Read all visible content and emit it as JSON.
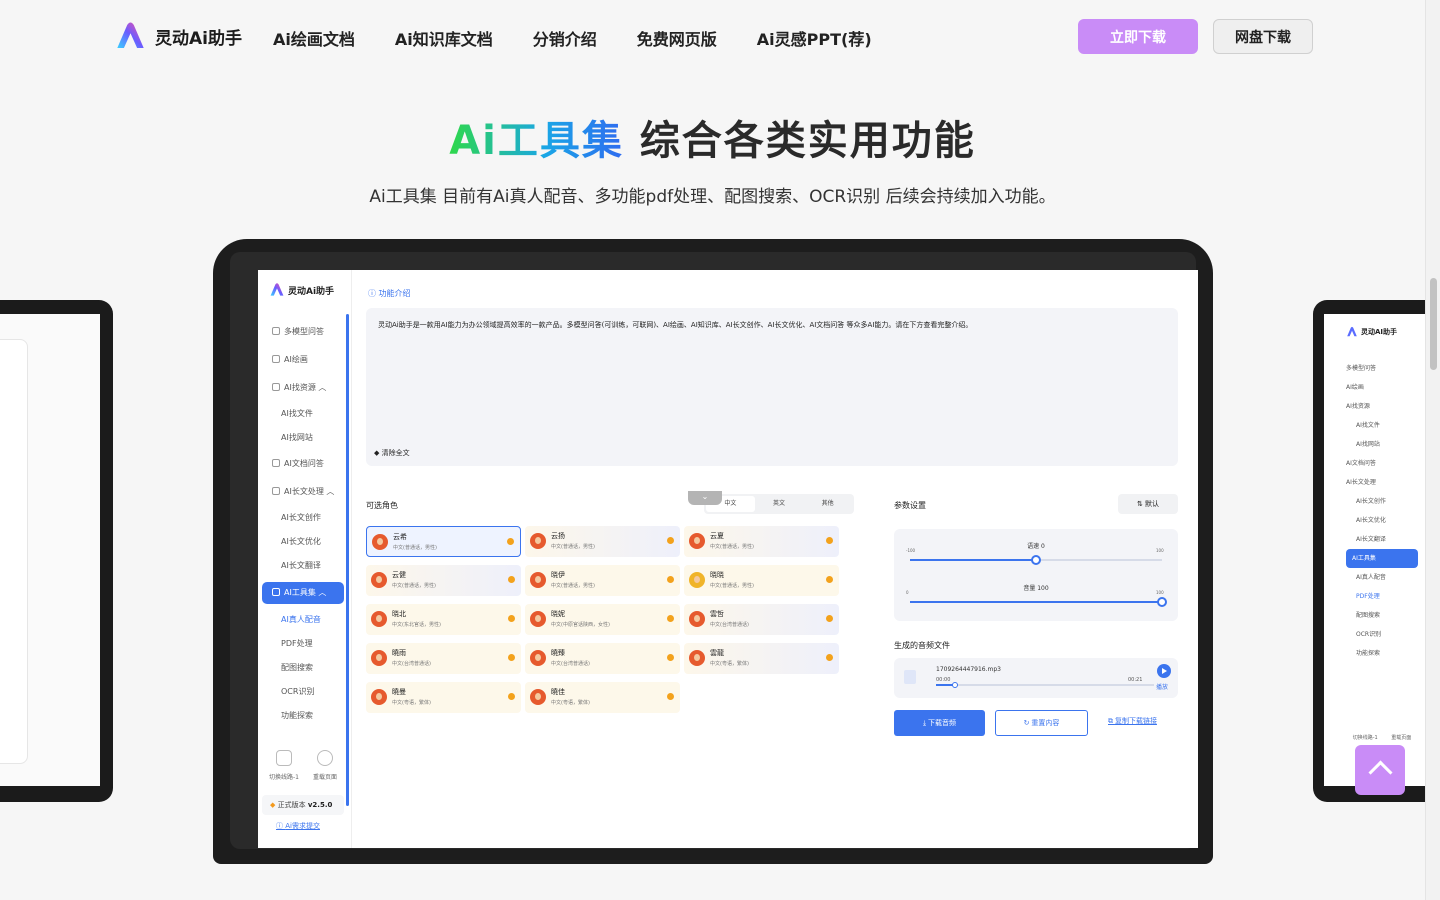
{
  "nav": {
    "brand": "灵动Ai助手",
    "links": [
      "Ai绘画文档",
      "Ai知识库文档",
      "分销介绍",
      "免费网页版",
      "Ai灵感PPT(荐)"
    ],
    "download_label": "立即下载",
    "pan_label": "网盘下载"
  },
  "hero": {
    "title_highlight": "Ai工具集",
    "title_rest": "综合各类实用功能",
    "subtitle": "Ai工具集 目前有Ai真人配音、多功能pdf处理、配图搜索、OCR识别 后续会持续加入功能。"
  },
  "app": {
    "brand": "灵动Ai助手",
    "sidebar": [
      {
        "label": "多模型问答",
        "kind": "grp"
      },
      {
        "label": "AI绘画",
        "kind": "grp"
      },
      {
        "label": "AI找资源",
        "kind": "grp"
      },
      {
        "label": "AI找文件",
        "kind": "sub"
      },
      {
        "label": "AI找网站",
        "kind": "sub"
      },
      {
        "label": "AI文档问答",
        "kind": "grp"
      },
      {
        "label": "AI长文处理",
        "kind": "grp"
      },
      {
        "label": "AI长文创作",
        "kind": "sub"
      },
      {
        "label": "AI长文优化",
        "kind": "sub"
      },
      {
        "label": "AI长文翻译",
        "kind": "sub"
      },
      {
        "label": "AI工具集",
        "kind": "active"
      },
      {
        "label": "AI真人配音",
        "kind": "subblue"
      },
      {
        "label": "PDF处理",
        "kind": "sub"
      },
      {
        "label": "配图搜索",
        "kind": "sub"
      },
      {
        "label": "OCR识别",
        "kind": "sub"
      },
      {
        "label": "功能探索",
        "kind": "sub"
      }
    ],
    "footer": {
      "tool1": "切换线路-1",
      "tool2": "重载页面",
      "version_label": "正式版本",
      "version": "v2.5.0",
      "request": "Ai需求提交"
    },
    "func_link": "功能介绍",
    "intro": "灵动Ai助手是一款用AI能力为办公领域提高效率的一款产品。多模型问答(可训练，可联网)、AI绘画、AI知识库、AI长文创作、AI长文优化、AI文档问答 等众多AI能力。请在下方查看完整介绍。",
    "clear": "清除全文",
    "roles_title": "可选角色",
    "lang_tabs": [
      "中文",
      "英文",
      "其他"
    ],
    "roles": [
      {
        "name": "云希",
        "desc": "中文(普通话，男性)"
      },
      {
        "name": "云扬",
        "desc": "中文(普通话，男性)"
      },
      {
        "name": "云夏",
        "desc": "中文(普通话，男性)"
      },
      {
        "name": "云健",
        "desc": "中文(普通话，男性)"
      },
      {
        "name": "晓伊",
        "desc": "中文(普通话，男性)"
      },
      {
        "name": "晓晓",
        "desc": "中文(普通话，男性)"
      },
      {
        "name": "晓北",
        "desc": "中文(东北官话，男性)"
      },
      {
        "name": "晓妮",
        "desc": "中文(中原官话陕西，女性)"
      },
      {
        "name": "雲哲",
        "desc": "中文(台湾普通话)"
      },
      {
        "name": "曉雨",
        "desc": "中文(台湾普通话)"
      },
      {
        "name": "曉臻",
        "desc": "中文(台湾普通话)"
      },
      {
        "name": "雲龍",
        "desc": "中文(粤语，繁体)"
      },
      {
        "name": "曉曼",
        "desc": "中文(粤语，繁体)"
      },
      {
        "name": "曉佳",
        "desc": "中文(粤语，繁体)"
      }
    ],
    "params_title": "参数设置",
    "default_label": "默认",
    "speed": {
      "label": "语速 0",
      "min": "-100",
      "max": "100",
      "value": 0
    },
    "volume": {
      "label": "音量 100",
      "min": "0",
      "max": "100",
      "value": 100
    },
    "audio_title": "生成的音频文件",
    "audio": {
      "file": "1709264447916.mp3",
      "current": "00:00",
      "total": "00:21",
      "play": "播放"
    },
    "buttons": {
      "download": "下载音频",
      "regen": "重置内容",
      "copy": "复制下载链接"
    }
  },
  "side_right": {
    "brand": "灵动AI助手",
    "items": [
      "多模型问答",
      "AI绘画",
      "AI找资源",
      "AI找文件",
      "AI找网站",
      "AI文档问答",
      "AI长文处理",
      "AI长文创作",
      "AI长文优化",
      "AI长文翻译",
      "AI工具集",
      "AI真人配音",
      "PDF处理",
      "配图搜索",
      "OCR识别",
      "功能探索"
    ],
    "tool1": "切换线路-1",
    "tool2": "重载页面"
  }
}
